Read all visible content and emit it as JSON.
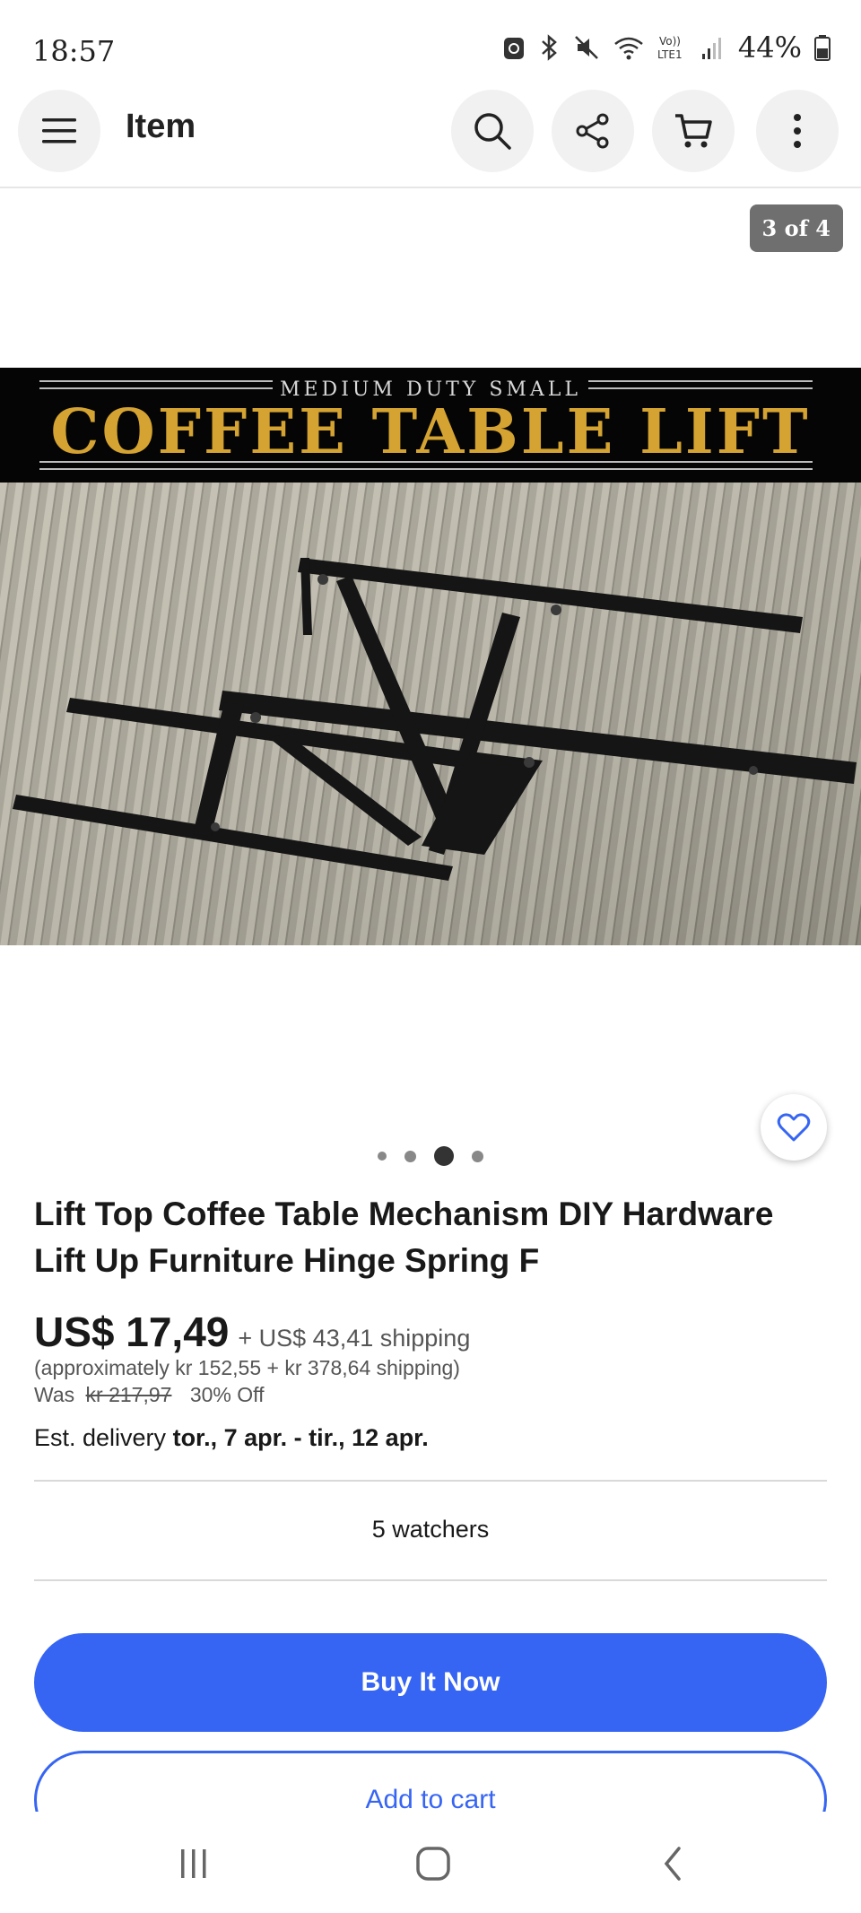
{
  "status_bar": {
    "time": "18:57",
    "battery": "44%",
    "network": "Vo)) LTE1"
  },
  "header": {
    "title": "Item",
    "icons": [
      "menu-icon",
      "search-icon",
      "share-icon",
      "cart-icon",
      "more-vert-icon"
    ]
  },
  "gallery": {
    "counter": "3 of 4",
    "banner_subtitle": "MEDIUM DUTY SMALL",
    "banner_title": "COFFEE TABLE LIFT",
    "dots_count": 4,
    "active_dot": 3
  },
  "item": {
    "title": "Lift Top Coffee Table Mechanism DIY Hardware Lift Up Furniture Hinge Spring F",
    "price": "US$ 17,49",
    "shipping": "+ US$ 43,41 shipping",
    "approx": "(approximately kr 152,55 + kr 378,64 shipping)",
    "was_label": "Was",
    "was_price": "kr 217,97",
    "discount": "30% Off",
    "delivery_label": "Est. delivery",
    "delivery_dates": "tor., 7 apr. - tir., 12 apr.",
    "watchers": "5 watchers"
  },
  "actions": {
    "buy_now": "Buy It Now",
    "add_to_cart": "Add to cart"
  },
  "colors": {
    "accent": "#3665f3",
    "banner_gold": "#d4a332"
  }
}
